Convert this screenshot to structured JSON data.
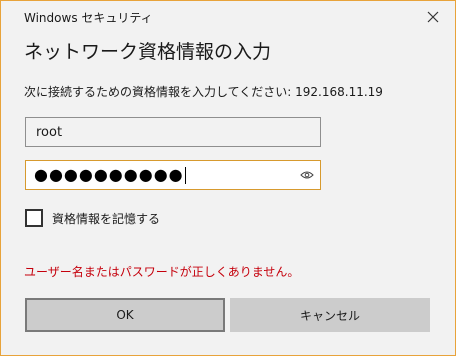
{
  "window": {
    "title": "Windows セキュリティ",
    "close_icon": "close-icon"
  },
  "dialog": {
    "heading": "ネットワーク資格情報の入力",
    "prompt": "次に接続するための資格情報を入力してください: 192.168.11.19"
  },
  "username": {
    "value": "root"
  },
  "password": {
    "masked_value": "●●●●●●●●●●",
    "reveal_icon": "eye-icon"
  },
  "remember": {
    "label": "資格情報を記憶する",
    "checked": false
  },
  "error": {
    "message": "ユーザー名またはパスワードが正しくありません。",
    "color": "#c5000c"
  },
  "buttons": {
    "ok": "OK",
    "cancel": "キャンセル"
  },
  "colors": {
    "accent_border": "#d79a2e",
    "window_frame": "#e8a33a"
  }
}
